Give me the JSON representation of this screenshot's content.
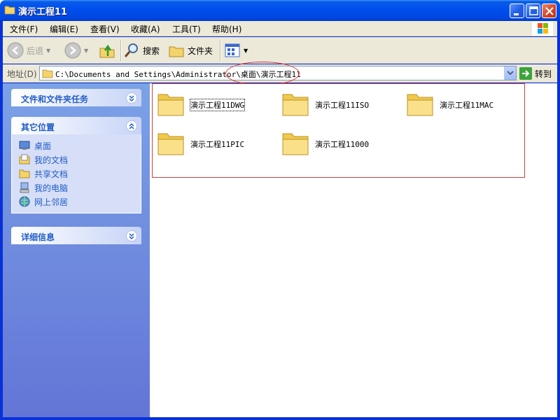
{
  "window": {
    "title": "演示工程11",
    "colors": {
      "titlebar": "#0050ee",
      "close": "#d5462a",
      "highlight": "#e03030"
    }
  },
  "menu": {
    "items": [
      "文件(F)",
      "编辑(E)",
      "查看(V)",
      "收藏(A)",
      "工具(T)",
      "帮助(H)"
    ]
  },
  "toolbar": {
    "back_label": "后退",
    "search_label": "搜索",
    "folders_label": "文件夹"
  },
  "address": {
    "label": "地址(D)",
    "value": "C:\\Documents and Settings\\Administrator\\桌面\\演示工程11",
    "go_label": "转到"
  },
  "tasks": {
    "file_tasks_title": "文件和文件夹任务",
    "other_places_title": "其它位置",
    "other_places": [
      {
        "label": "桌面",
        "icon": "desktop-icon"
      },
      {
        "label": "我的文档",
        "icon": "my-documents-icon"
      },
      {
        "label": "共享文档",
        "icon": "shared-documents-icon"
      },
      {
        "label": "我的电脑",
        "icon": "my-computer-icon"
      },
      {
        "label": "网上邻居",
        "icon": "network-places-icon"
      }
    ],
    "details_title": "详细信息"
  },
  "folders": [
    {
      "name": "演示工程11DWG",
      "focused": true
    },
    {
      "name": "演示工程11ISO",
      "focused": false
    },
    {
      "name": "演示工程11MAC",
      "focused": false
    },
    {
      "name": "演示工程11PIC",
      "focused": false
    },
    {
      "name": "演示工程11000",
      "focused": false
    }
  ]
}
